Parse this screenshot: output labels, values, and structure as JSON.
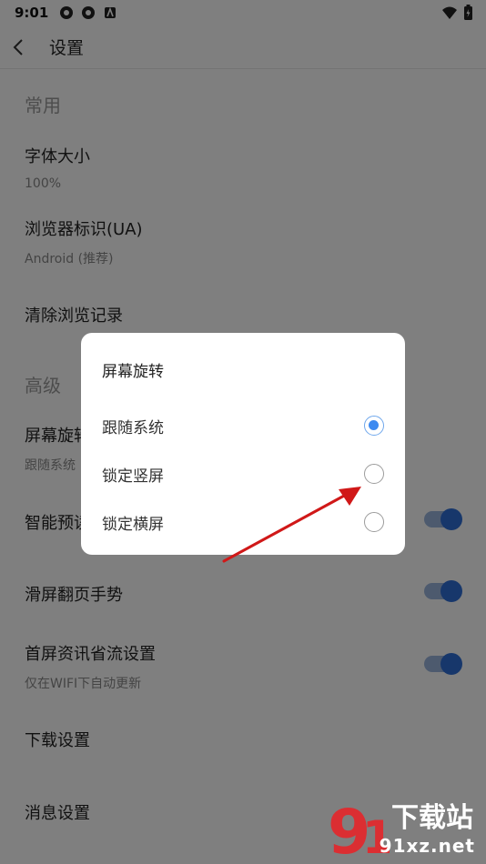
{
  "status_bar": {
    "time": "9:01"
  },
  "app_bar": {
    "title": "设置"
  },
  "sections": {
    "common_header": "常用",
    "advanced_header": "高级"
  },
  "rows": {
    "font_size": {
      "label": "字体大小",
      "value": "100%"
    },
    "ua": {
      "label": "浏览器标识(UA)",
      "value": "Android (推荐)"
    },
    "clear_history": {
      "label": "清除浏览记录"
    },
    "screen_rotation": {
      "label": "屏幕旋转",
      "value": "跟随系统"
    },
    "smart_preload": {
      "label": "智能预读",
      "on": true
    },
    "swipe_page": {
      "label": "滑屏翻页手势",
      "on": true
    },
    "homepage_saving": {
      "label": "首屏资讯省流设置",
      "value": "仅在WIFI下自动更新",
      "on": true
    },
    "download": {
      "label": "下载设置"
    },
    "message": {
      "label": "消息设置"
    }
  },
  "dialog": {
    "title": "屏幕旋转",
    "options": [
      {
        "label": "跟随系统",
        "selected": true
      },
      {
        "label": "锁定竖屏",
        "selected": false
      },
      {
        "label": "锁定横屏",
        "selected": false
      }
    ]
  },
  "watermark": {
    "brand": "下载站",
    "site": "91xz.net"
  },
  "colors": {
    "accent": "#2f6fd6",
    "radio_checked": "#3d8af0",
    "annotation_arrow": "#d01818"
  }
}
